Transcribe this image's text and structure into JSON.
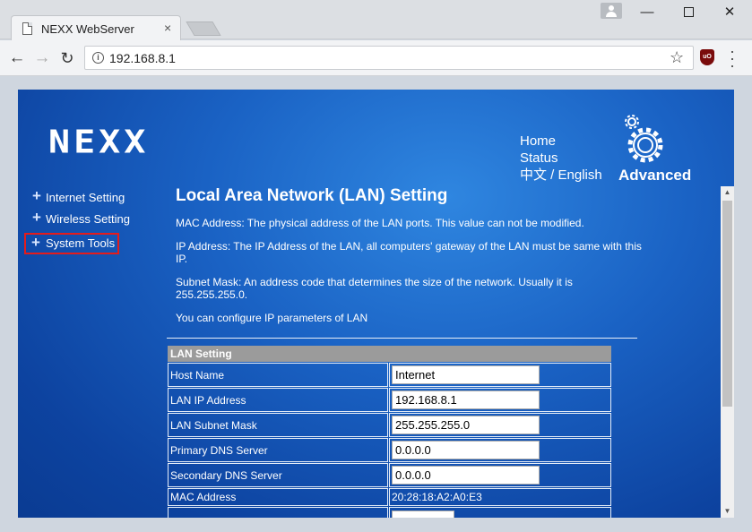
{
  "browser": {
    "tab_title": "NEXX WebServer",
    "tab_close": "×",
    "url": "192.168.8.1",
    "info_icon": "i",
    "ublock_label": "uO"
  },
  "logo_text": "NEXX",
  "topnav": {
    "home": "Home",
    "status": "Status",
    "language": "中文 / English",
    "advanced": "Advanced"
  },
  "sidenav": {
    "items": [
      {
        "label": "Internet Setting"
      },
      {
        "label": "Wireless Setting"
      },
      {
        "label": "System Tools"
      }
    ]
  },
  "content": {
    "title": "Local Area Network (LAN) Setting",
    "descriptions": [
      "MAC Address: The physical address of the LAN ports. This value can not be modified.",
      "IP Address: The IP Address of the LAN, all computers' gateway of the LAN must be same with this IP.",
      "Subnet Mask: An address code that determines the size of the network. Usually it is 255.255.255.0.",
      "You can configure IP parameters of LAN"
    ]
  },
  "lan_setting": {
    "header": "LAN Setting",
    "rows": [
      {
        "label": "Host Name",
        "value": "Internet"
      },
      {
        "label": "LAN IP Address",
        "value": "192.168.8.1"
      },
      {
        "label": "LAN Subnet Mask",
        "value": "255.255.255.0"
      },
      {
        "label": "Primary DNS Server",
        "value": "0.0.0.0"
      },
      {
        "label": "Secondary DNS Server",
        "value": "0.0.0.0"
      }
    ],
    "mac_label": "MAC Address",
    "mac_value": "20:28:18:A2:A0:E3"
  },
  "icons": {
    "back": "back-arrow-icon",
    "forward": "forward-arrow-icon",
    "reload": "reload-icon",
    "bookmark": "star-icon",
    "settings": "gear-icon"
  },
  "colors": {
    "page_blue": "#1a62c4",
    "highlight": "#e41c1c",
    "table_header": "#9b9b9b"
  }
}
